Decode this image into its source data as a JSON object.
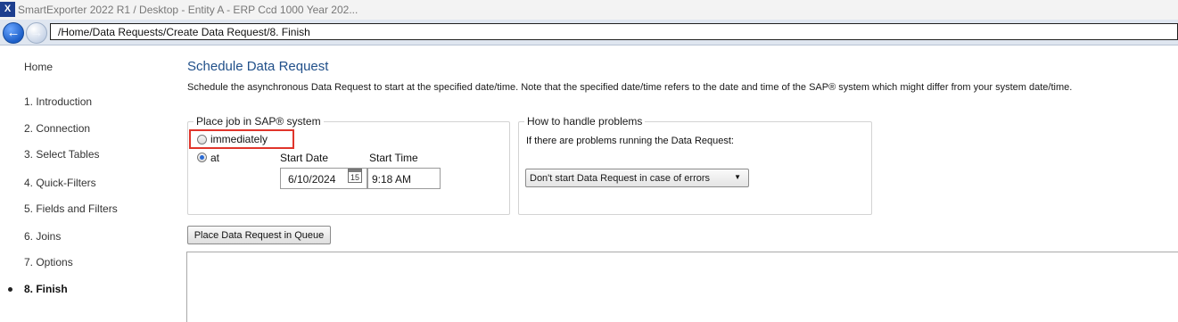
{
  "window": {
    "title": "SmartExporter 2022 R1 / Desktop - Entity A - ERP Ccd 1000 Year 202...",
    "app_icon": "smartexporter-icon"
  },
  "navigation": {
    "back_icon": "back-arrow-icon",
    "forward_icon": "forward-arrow-icon",
    "path": "/Home/Data Requests/Create Data Request/8. Finish"
  },
  "sidebar": {
    "home": "Home",
    "items": [
      {
        "label": "1. Introduction"
      },
      {
        "label": "2. Connection"
      },
      {
        "label": "3. Select Tables"
      },
      {
        "label": "4. Quick-Filters"
      },
      {
        "label": "5. Fields and Filters"
      },
      {
        "label": "6. Joins"
      },
      {
        "label": "7. Options"
      },
      {
        "label": "8. Finish",
        "active": true
      }
    ]
  },
  "main": {
    "title": "Schedule Data Request",
    "description": "Schedule the asynchronous Data Request to start at the specified date/time. Note that the specified date/time refers to the date and time of the SAP® system which might differ from your system date/time.",
    "place_job": {
      "legend": "Place job in SAP® system",
      "option_immediately": "immediately",
      "option_at": "at",
      "selected": "at",
      "start_date_label": "Start Date",
      "start_date_value": "6/10/2024",
      "calendar_day": "15",
      "start_time_label": "Start Time",
      "start_time_value": "9:18 AM"
    },
    "problems": {
      "legend": "How to handle problems",
      "text": "If there are problems running the Data Request:",
      "selected_option": "Don't start Data Request in case of errors"
    },
    "queue_button": "Place Data Request in Queue"
  },
  "colors": {
    "title_blue": "#21508a",
    "highlight_red": "#e0352b",
    "radio_blue": "#2a6ad3"
  }
}
